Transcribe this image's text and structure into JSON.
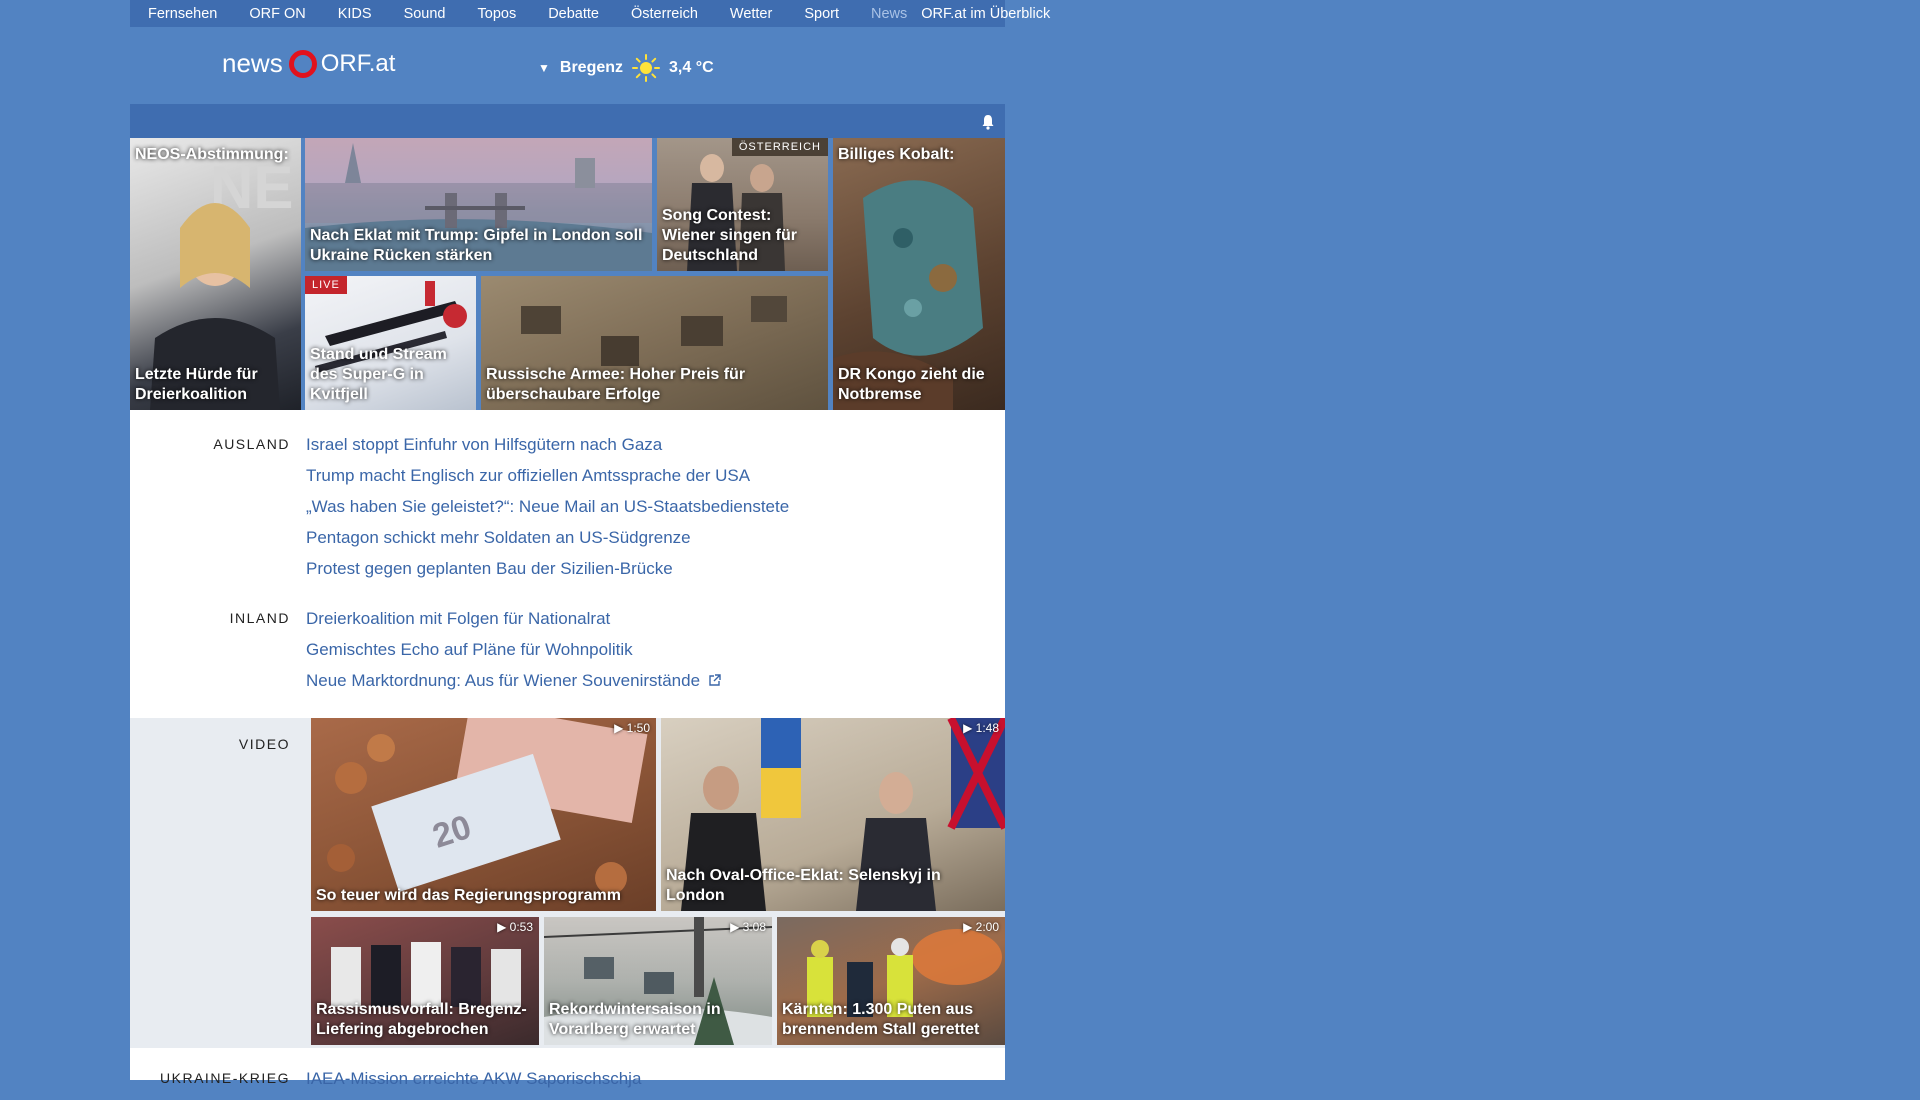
{
  "nav": {
    "items": [
      "Fernsehen",
      "ORF ON",
      "KIDS",
      "Sound",
      "Topos",
      "Debatte",
      "Österreich",
      "Wetter",
      "Sport",
      "News"
    ],
    "overview": "ORF.at im Überblick"
  },
  "brand": {
    "news": "news",
    "site": "ORF.at"
  },
  "weather": {
    "location": "Bregenz",
    "temp": "3,4 °C",
    "icon": "sun-icon"
  },
  "hero": {
    "neos": {
      "top": "NEOS-Abstimmung:",
      "caption": "Letzte Hürde für Dreierkoalition"
    },
    "london": {
      "caption": "Nach Eklat mit Trump: Gipfel in London soll Ukraine Rücken stärken"
    },
    "song": {
      "tag": "ÖSTERREICH",
      "caption": "Song Contest: Wiener singen für Deutschland"
    },
    "kobalt": {
      "top": "Billiges Kobalt:",
      "caption": "DR Kongo zieht die Notbremse"
    },
    "ski": {
      "tag": "LIVE",
      "caption": "Stand und Stream des Super-G in Kvitfjell"
    },
    "armee": {
      "caption": "Russische Armee: Hoher Preis für überschaubare Erfolge"
    }
  },
  "ausland": {
    "label": "AUSLAND",
    "items": [
      "Israel stoppt Einfuhr von Hilfsgütern nach Gaza",
      "Trump macht Englisch zur offiziellen Amtssprache der USA",
      "„Was haben Sie geleistet?“: Neue Mail an US-Staatsbedienstete",
      "Pentagon schickt mehr Soldaten an US-Südgrenze",
      "Protest gegen geplanten Bau der Sizilien-Brücke"
    ]
  },
  "inland": {
    "label": "INLAND",
    "items": [
      "Dreierkoalition mit Folgen für Nationalrat",
      "Gemischtes Echo auf Pläne für Wohnpolitik",
      "Neue Marktordnung: Aus für Wiener Souvenirstände"
    ]
  },
  "video": {
    "label": "VIDEO",
    "items": [
      {
        "caption": "So teuer wird das Regierungsprogramm",
        "duration": "1:50"
      },
      {
        "caption": "Nach Oval-Office-Eklat: Selenskyj in London",
        "duration": "1:48"
      },
      {
        "caption": "Rassismusvorfall: Bregenz-Liefering abgebrochen",
        "duration": "0:53"
      },
      {
        "caption": "Rekordwintersaison in Vorarlberg erwartet",
        "duration": "3:08"
      },
      {
        "caption": "Kärnten: 1.300 Puten aus brennendem Stall gerettet",
        "duration": "2:00"
      }
    ]
  },
  "ukraine": {
    "label": "UKRAINE-KRIEG",
    "items": [
      "IAEA-Mission erreichte AKW Saporischschja"
    ]
  },
  "colors": {
    "background": "#5283c2",
    "nav": "#3f6db0",
    "link": "#3a66a8",
    "orf_red": "#e1121d",
    "live": "#c4252c"
  }
}
